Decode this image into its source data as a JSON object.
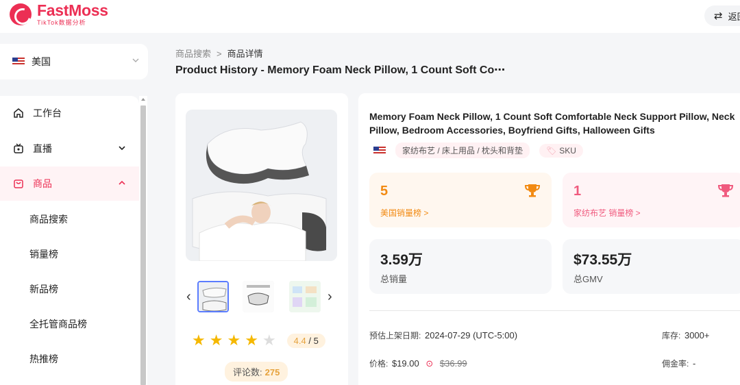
{
  "brand": {
    "name": "FastMoss",
    "tagline": "TikTok数据分析",
    "color": "#ec2f54"
  },
  "topbar": {
    "back_label": "返回"
  },
  "country": {
    "label": "美国"
  },
  "sidebar": {
    "items": [
      {
        "label": "工作台",
        "icon": "home-icon"
      },
      {
        "label": "直播",
        "icon": "live-icon"
      },
      {
        "label": "商品",
        "icon": "bag-icon"
      }
    ],
    "sub_items": [
      "商品搜索",
      "销量榜",
      "新品榜",
      "全托管商品榜",
      "热推榜"
    ]
  },
  "breadcrumb": {
    "parent": "商品搜索",
    "current": "商品详情"
  },
  "page_title": "Product History - Memory Foam Neck Pillow, 1 Count Soft Co⋯",
  "product": {
    "title": "Memory Foam Neck Pillow, 1 Count Soft Comfortable Neck Support Pillow, Neck Pillow, Bedroom Accessories, Boyfriend Gifts, Halloween Gifts",
    "category": "家纺布艺 / 床上用品 / 枕头和背垫",
    "sku_label": "SKU",
    "rating": {
      "value": "4.4",
      "max": "/ 5",
      "stars": 4
    },
    "reviews": {
      "label": "评论数:",
      "count": "275"
    }
  },
  "stats": {
    "country_rank": {
      "value": "5",
      "label": "美国销量榜 >"
    },
    "category_rank": {
      "value": "1",
      "label": "家纺布艺 销量榜 >"
    },
    "total_sales": {
      "value": "3.59万",
      "label": "总销量"
    },
    "total_gmv": {
      "value": "$73.55万",
      "label": "总GMV"
    }
  },
  "meta": {
    "listed_label": "预估上架日期:",
    "listed_value": "2024-07-29 (UTC-5:00)",
    "stock_label": "库存:",
    "stock_value": "3000+",
    "price_label": "价格:",
    "price_value": "$19.00",
    "original_price": "$36.99",
    "commission_label": "佣金率:",
    "commission_value": "-"
  }
}
